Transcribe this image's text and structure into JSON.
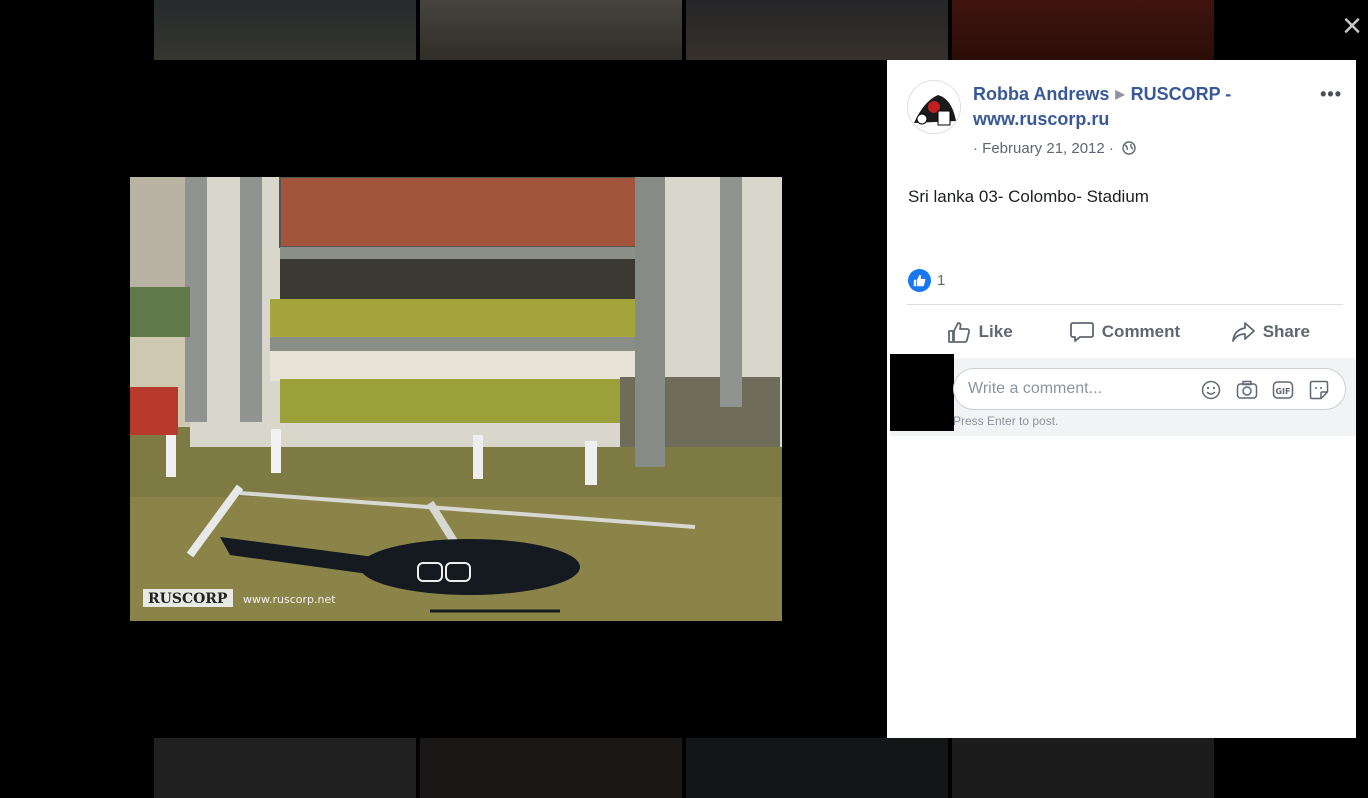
{
  "window": {
    "close_label": "×"
  },
  "photo": {
    "watermark_brand": "RUSCORP",
    "watermark_url": "www.ruscorp.net"
  },
  "post": {
    "author": "Robba Andrews",
    "page": "RUSCORP - www.ruscorp.ru",
    "date": "· February 21, 2012 ·",
    "caption": "Sri lanka 03- Colombo- Stadium",
    "more_label": "•••",
    "reactions": {
      "icon": "thumbs-up-icon",
      "count": "1"
    },
    "actions": {
      "like": "Like",
      "comment": "Comment",
      "share": "Share"
    }
  },
  "comment": {
    "placeholder": "Write a comment...",
    "hint": "Press Enter to post.",
    "icons": [
      "emoji-icon",
      "camera-icon",
      "gif-icon",
      "sticker-icon"
    ]
  },
  "colors": {
    "accent": "#385898",
    "like_blue": "#1877f2",
    "panel_bg": "#ffffff"
  }
}
